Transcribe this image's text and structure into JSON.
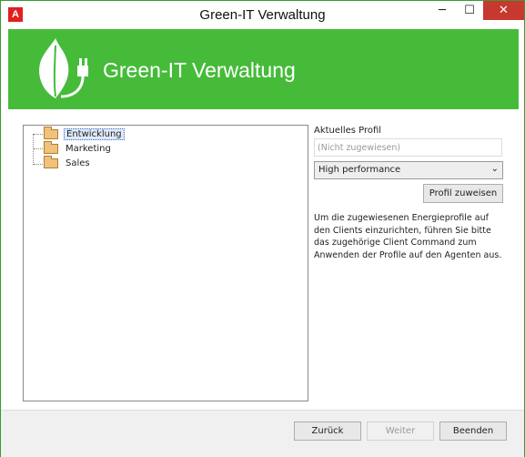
{
  "window": {
    "app_icon": "A",
    "title": "Green-IT Verwaltung",
    "controls": {
      "minimize": "─",
      "maximize": "☐",
      "close": "✕"
    }
  },
  "banner": {
    "title": "Green-IT Verwaltung",
    "logo_icon": "leaf-plug-icon",
    "color": "#46bb3a"
  },
  "tree": {
    "items": [
      {
        "label": "Entwicklung",
        "selected": true
      },
      {
        "label": "Marketing",
        "selected": false
      },
      {
        "label": "Sales",
        "selected": false
      }
    ]
  },
  "profile": {
    "label": "Aktuelles Profil",
    "current_placeholder": "(Nicht zugewiesen)",
    "selected_option": "High performance",
    "assign_button": "Profil zuweisen",
    "info_text": "Um die zugewiesenen Energieprofile auf den Clients einzurichten, führen Sie bitte das zugehörige Client Command zum Anwenden der Profile auf den Agenten aus."
  },
  "footer": {
    "back": "Zurück",
    "next": "Weiter",
    "finish": "Beenden"
  }
}
